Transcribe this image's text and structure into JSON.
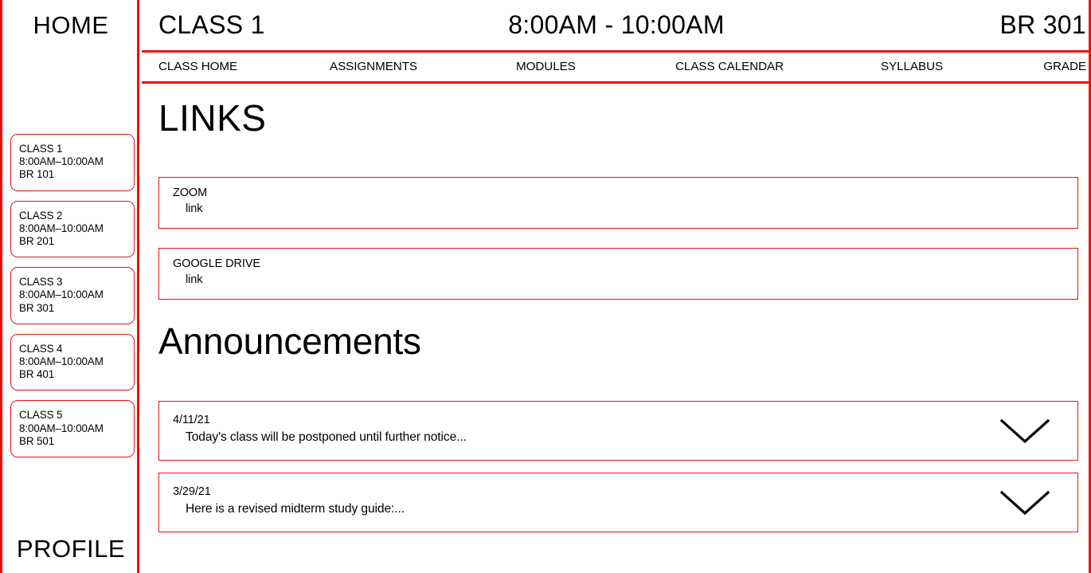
{
  "sidebar": {
    "home_label": "HOME",
    "profile_label": "PROFILE",
    "classes": [
      {
        "name": "CLASS 1",
        "time": "8:00AM–10:00AM",
        "room": "BR 101"
      },
      {
        "name": "CLASS 2",
        "time": "8:00AM–10:00AM",
        "room": "BR 201"
      },
      {
        "name": "CLASS 3",
        "time": "8:00AM–10:00AM",
        "room": "BR 301"
      },
      {
        "name": "CLASS 4",
        "time": "8:00AM–10:00AM",
        "room": "BR 401"
      },
      {
        "name": "CLASS 5",
        "time": "8:00AM–10:00AM",
        "room": "BR 501"
      }
    ]
  },
  "header": {
    "title": "CLASS 1",
    "time": "8:00AM - 10:00AM",
    "room": "BR 301"
  },
  "nav": {
    "tabs": [
      {
        "label": "CLASS HOME"
      },
      {
        "label": "ASSIGNMENTS"
      },
      {
        "label": "MODULES"
      },
      {
        "label": "CLASS CALENDAR"
      },
      {
        "label": "SYLLABUS"
      },
      {
        "label": "GRADE"
      }
    ]
  },
  "links_section": {
    "title": "LINKS",
    "items": [
      {
        "name": "ZOOM",
        "url_label": "link"
      },
      {
        "name": "GOOGLE DRIVE",
        "url_label": "link"
      }
    ]
  },
  "announcements_section": {
    "title": "Announcements",
    "items": [
      {
        "date": "4/11/21",
        "preview": "Today's class will be postponed until further notice...",
        "expand_icon": "chevron-down-icon"
      },
      {
        "date": "3/29/21",
        "preview": "Here is a revised midterm study guide:...",
        "expand_icon": "chevron-down-icon"
      }
    ]
  },
  "colors": {
    "accent": "#ee1111",
    "text": "#000000",
    "background": "#ffffff"
  }
}
